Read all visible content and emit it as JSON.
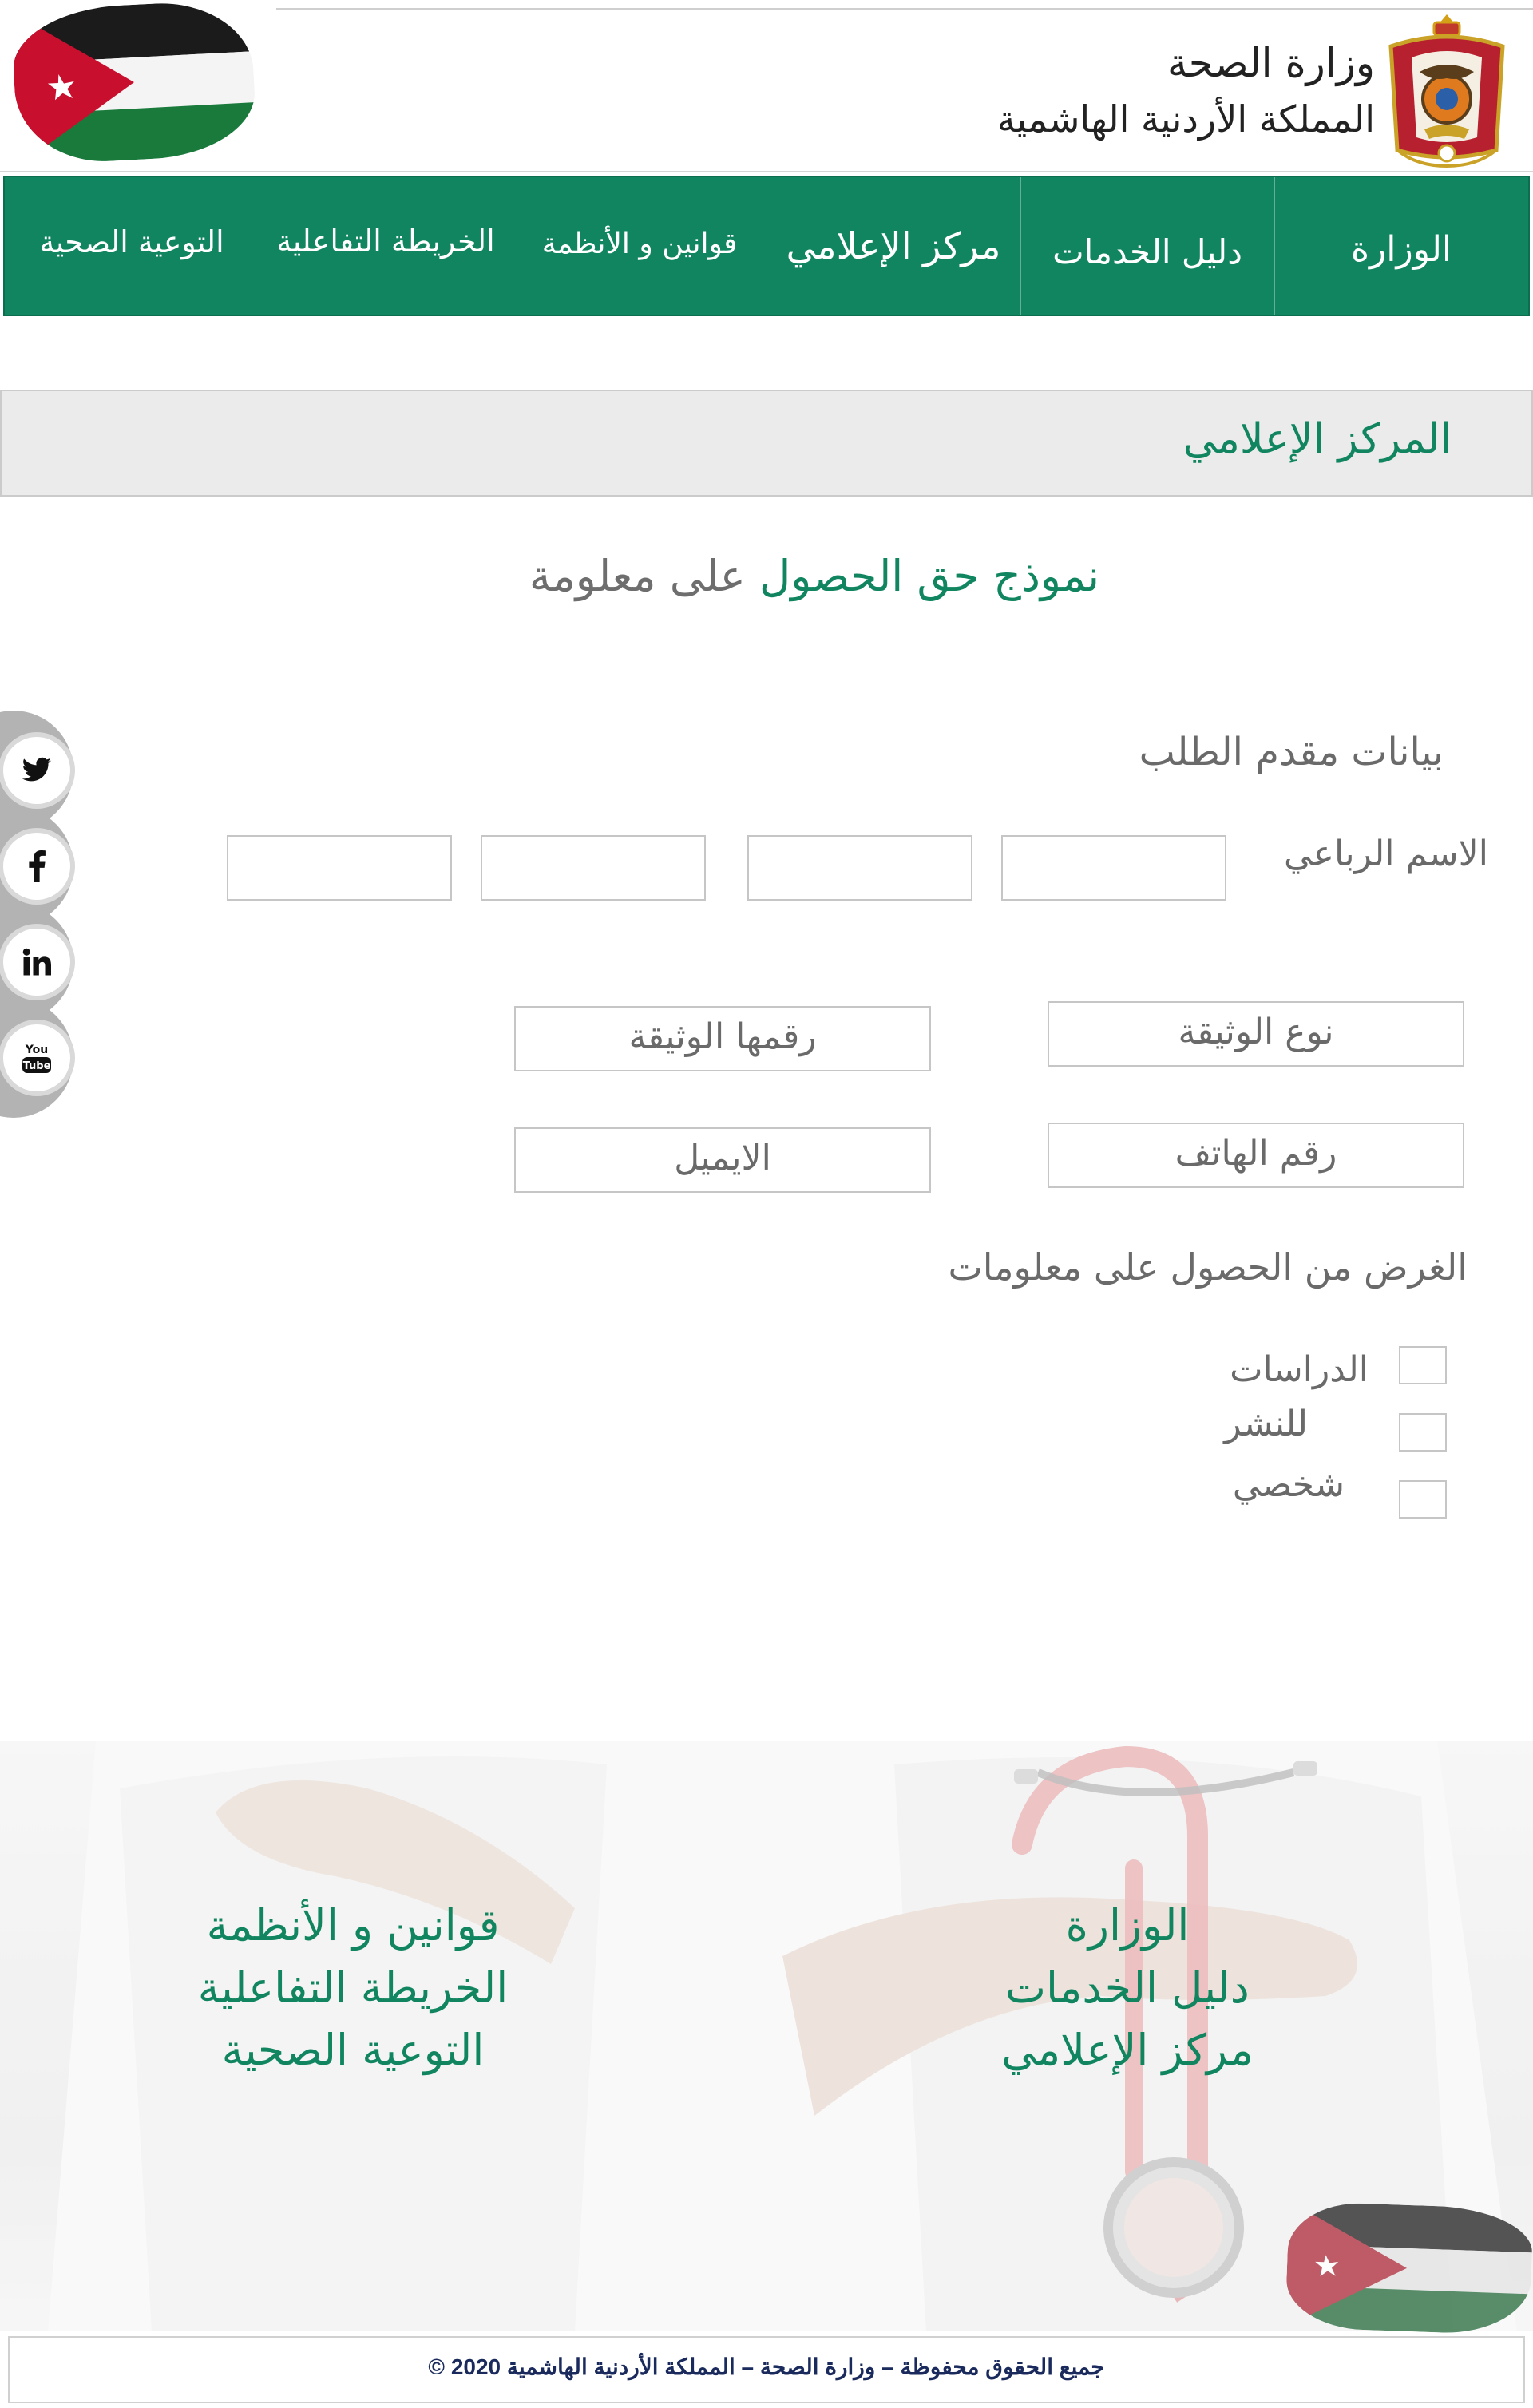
{
  "header": {
    "ministry_name": "وزارة الصحة",
    "kingdom_name": "المملكة الأردنية الهاشمية"
  },
  "nav": {
    "items": [
      {
        "label": "الوزارة"
      },
      {
        "label": "دليل الخدمات"
      },
      {
        "label": "مركز الإعلامي"
      },
      {
        "label": "قوانين و الأنظمة"
      },
      {
        "label": "الخريطة التفاعلية"
      },
      {
        "label": "التوعية الصحية"
      }
    ]
  },
  "banner": {
    "title": "المركز الإعلامي"
  },
  "form": {
    "title_green": "نموذج حق الحصول",
    "title_gray": "على معلومة",
    "section_title": "بيانات مقدم الطلب",
    "full_name_label": "الاسم  الرباعي",
    "document_type_placeholder": "نوع الوثيقة",
    "document_number_placeholder": "رقمها الوثيقة",
    "phone_placeholder": "رقم الهاتف",
    "email_placeholder": "الايميل",
    "purpose_label": "الغرض من الحصول على معلومات",
    "purpose_options": [
      {
        "label": "الدراسات"
      },
      {
        "label": "للنشر"
      },
      {
        "label": "شخصي"
      }
    ]
  },
  "social": [
    {
      "icon": "twitter-icon"
    },
    {
      "icon": "facebook-icon"
    },
    {
      "icon": "linkedin-icon"
    },
    {
      "icon": "youtube-icon"
    }
  ],
  "footer": {
    "links_right": [
      "الوزارة",
      "دليل الخدمات",
      "مركز الإعلامي"
    ],
    "links_left": [
      "قوانين و الأنظمة",
      "الخريطة التفاعلية",
      "التوعية الصحية"
    ],
    "copyright": "جميع الحقوق محفوظة – وزارة الصحة – المملكة الأردنية الهاشمية 2020 ©"
  },
  "colors": {
    "brand_green": "#10855f",
    "flag_red": "#ce1126",
    "flag_green": "#007a3d",
    "flag_black": "#000000"
  }
}
